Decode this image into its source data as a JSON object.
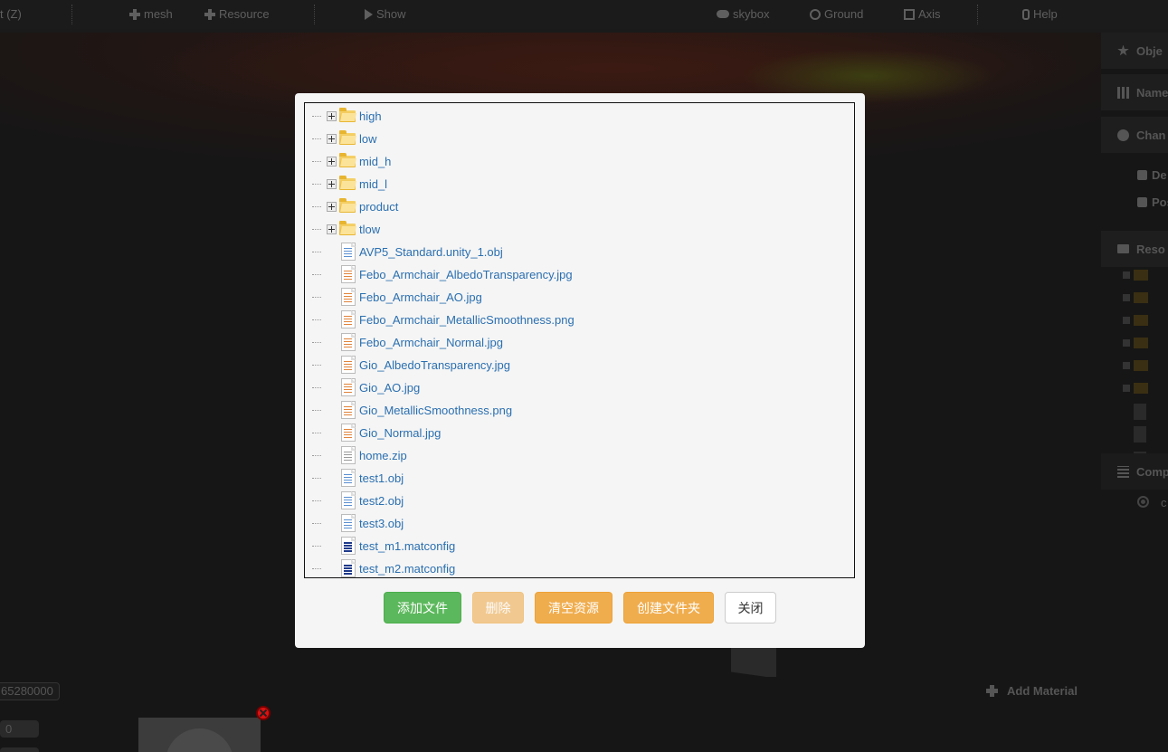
{
  "toolbar": {
    "select_label": "t (Z)",
    "mesh_label": "mesh",
    "resource_label": "Resource",
    "show_label": "Show",
    "skybox_label": "skybox",
    "ground_label": "Ground",
    "axis_label": "Axis",
    "help_label": "Help"
  },
  "right_panel": {
    "object_label": "Obje",
    "name_label": "Name",
    "channel_label": "Chan",
    "check_1_label": "De",
    "check_2_label": "Pos",
    "resource_label": "Reso",
    "component_label": "Comp",
    "radio_label": "c"
  },
  "bottom_panel": {
    "value_field": "65280000",
    "number_field": "0",
    "add_material_label": "Add Material"
  },
  "file_dialog": {
    "folders": [
      "high",
      "low",
      "mid_h",
      "mid_l",
      "product",
      "tlow"
    ],
    "files": [
      {
        "name": "AVP5_Standard.unity_1.obj",
        "kind": "obj"
      },
      {
        "name": "Febo_Armchair_AlbedoTransparency.jpg",
        "kind": "img"
      },
      {
        "name": "Febo_Armchair_AO.jpg",
        "kind": "img"
      },
      {
        "name": "Febo_Armchair_MetallicSmoothness.png",
        "kind": "img"
      },
      {
        "name": "Febo_Armchair_Normal.jpg",
        "kind": "img"
      },
      {
        "name": "Gio_AlbedoTransparency.jpg",
        "kind": "img"
      },
      {
        "name": "Gio_AO.jpg",
        "kind": "img"
      },
      {
        "name": "Gio_MetallicSmoothness.png",
        "kind": "img"
      },
      {
        "name": "Gio_Normal.jpg",
        "kind": "img"
      },
      {
        "name": "home.zip",
        "kind": "zip"
      },
      {
        "name": "test1.obj",
        "kind": "obj"
      },
      {
        "name": "test2.obj",
        "kind": "obj"
      },
      {
        "name": "test3.obj",
        "kind": "obj"
      },
      {
        "name": "test_m1.matconfig",
        "kind": "mat"
      },
      {
        "name": "test_m2.matconfig",
        "kind": "mat"
      }
    ],
    "buttons": {
      "add_file": "添加文件",
      "delete": "删除",
      "clear_resources": "清空资源",
      "create_folder": "创建文件夹",
      "close": "关闭"
    }
  }
}
